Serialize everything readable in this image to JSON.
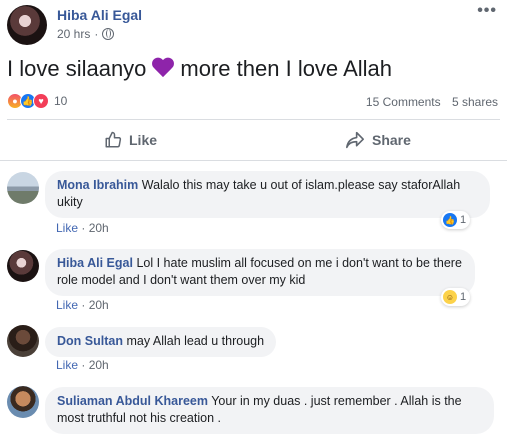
{
  "post": {
    "author": "Hiba Ali Egal",
    "time": "20 hrs",
    "dot": "·",
    "menu": "•••",
    "text_before": "I love silaanyo",
    "text_after": "more then I love Allah",
    "reaction_count": "10",
    "comments_count": "15 Comments",
    "shares_count": "5 shares"
  },
  "actions": {
    "like": "Like",
    "share": "Share"
  },
  "comments": [
    {
      "name": "Mona Ibrahim",
      "text": "Walalo this may take u out of islam.please say staforAllah ukity",
      "like": "Like",
      "dot": "·",
      "time": "20h",
      "reaction": "1",
      "reaction_type": "like"
    },
    {
      "name": "Hiba Ali Egal",
      "text": "Lol I hate muslim all focused on me i don't want to be there role model and I don't want them over my kid",
      "like": "Like",
      "dot": "·",
      "time": "20h",
      "reaction": "1",
      "reaction_type": "haha"
    },
    {
      "name": "Don Sultan",
      "text": "may Allah lead u through",
      "like": "Like",
      "dot": "·",
      "time": "20h"
    },
    {
      "name": "Suliaman Abdul Khareem",
      "text": "Your in my duas . just remember . Allah is the most truthful not his creation ."
    }
  ],
  "colors": {
    "link": "#385898",
    "heart": "#8e24aa",
    "like_blue": "#1877f2"
  }
}
